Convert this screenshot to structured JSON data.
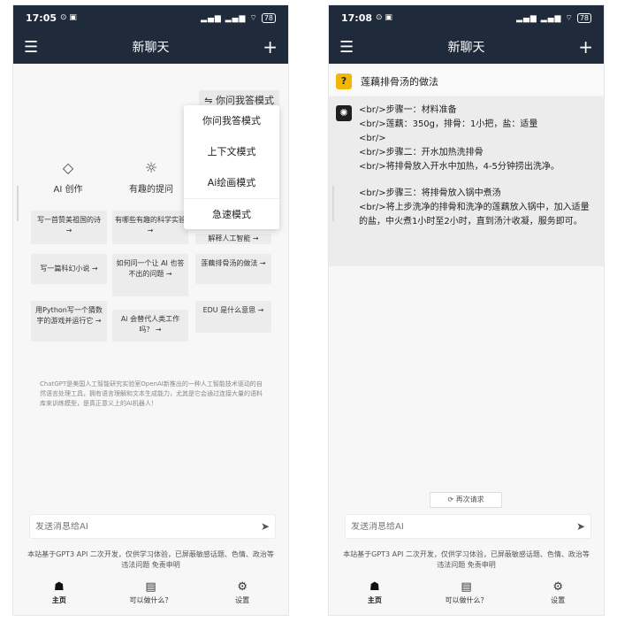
{
  "phone1": {
    "status": {
      "time": "17:05",
      "icons": "⊙ ▣",
      "signal": "▂▄▆ ▂▄▆ ⌔",
      "battery": "78"
    },
    "title": "新聊天",
    "mode_button": "⇋ 你问我答模式",
    "dropdown": [
      "你问我答模式",
      "上下文模式",
      "Ai绘画模式",
      "急速模式"
    ],
    "features": [
      {
        "icon": "◇",
        "label": "AI 创作"
      },
      {
        "icon": "☼",
        "label": "有趣的提问"
      }
    ],
    "cards": [
      "写一首赞美祖国的诗 →",
      "有哪些有趣的科学实验 →",
      "解释人工智能 →",
      "写一篇科幻小说 →",
      "如何问一个让 AI 也答不出的问题 →",
      "莲藕排骨汤的做法 →",
      "用Python写一个猜数字的游戏并运行它 →",
      "Ai 会替代人类工作吗？ →",
      "EDU 是什么意思 →"
    ],
    "intro": "ChatGPT是美国人工智能研究实验室OpenAI新推出的一种人工智能技术驱动的自然语言处理工具，拥有语言理解和文本生成能力，尤其是它会通过连接大量的语料库来训练模型，是真正意义上的AI机器人！",
    "input_placeholder": "发送消息给AI",
    "send": "➤",
    "disclaimer": "本站基于GPT3 API 二次开发，仅供学习体验，已屏蔽敏感话题、色情、政治等违法问题 免责申明",
    "nav": [
      {
        "icon": "☗",
        "label": "主页"
      },
      {
        "icon": "▤",
        "label": "可以做什么？"
      },
      {
        "icon": "⚙",
        "label": "设置"
      }
    ]
  },
  "phone2": {
    "status": {
      "time": "17:08",
      "icons": "⊙ ▣",
      "signal": "▂▄▆ ▂▄▆ ⌔",
      "battery": "78"
    },
    "title": "新聊天",
    "question": "莲藕排骨汤的做法",
    "answer_lines": [
      "<br/>步骤一：材料准备",
      "<br/>莲藕：350g，排骨：1小把，盐：适量",
      "<br/>",
      "<br/>步骤二：开水加热洗排骨",
      "<br/>将排骨放入开水中加热，4-5分钟捞出洗净。",
      "",
      "<br/>步骤三：将排骨放入锅中煮汤",
      "<br/>将上步洗净的排骨和洗净的莲藕放入锅中，加入适量的盐，中火煮1小时至2小时，直到汤汁收凝，服务即可。"
    ],
    "retry": "⟳ 再次请求",
    "input_placeholder": "发送消息给AI",
    "send": "➤",
    "disclaimer": "本站基于GPT3 API 二次开发，仅供学习体验，已屏蔽敏感话题、色情、政治等违法问题 免责申明",
    "nav": [
      {
        "icon": "☗",
        "label": "主页"
      },
      {
        "icon": "▤",
        "label": "可以做什么？"
      },
      {
        "icon": "⚙",
        "label": "设置"
      }
    ]
  }
}
